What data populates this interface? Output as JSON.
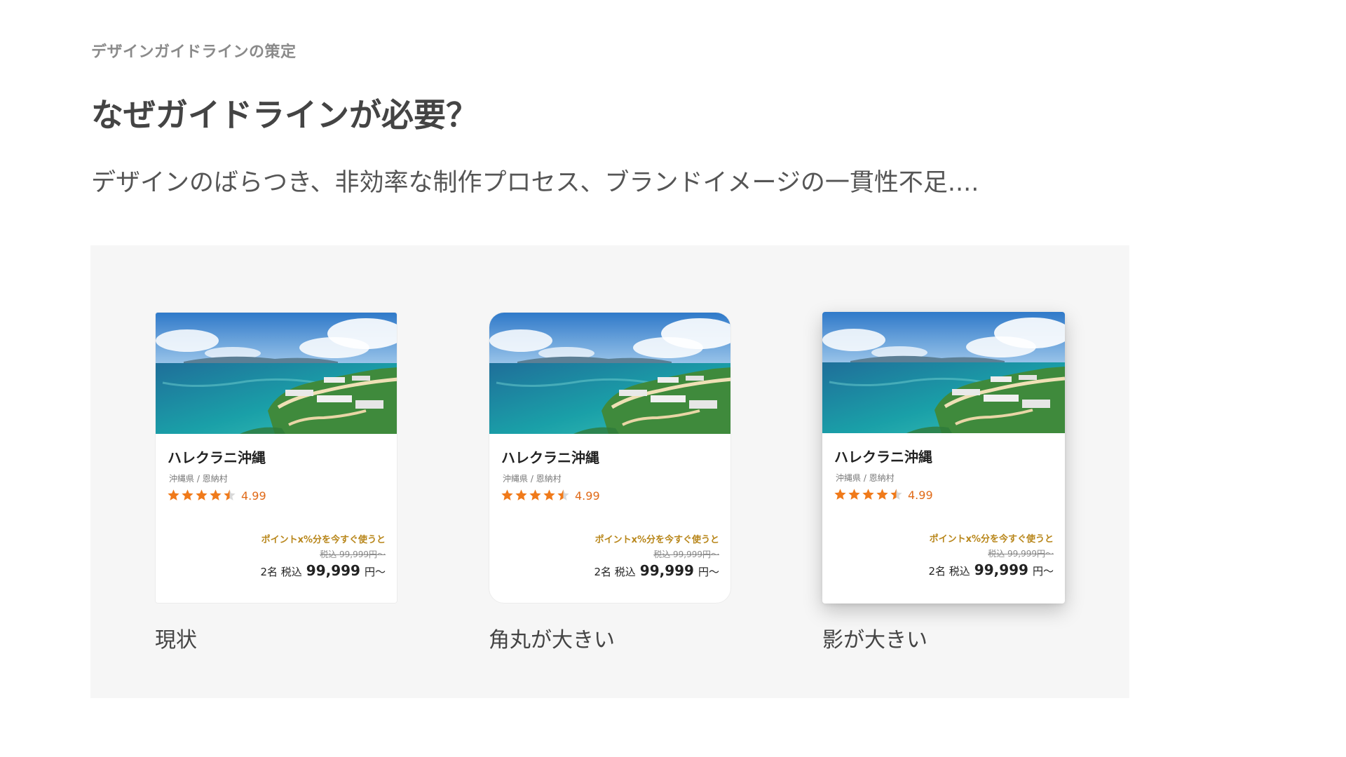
{
  "header": {
    "eyebrow": "デザインガイドラインの策定",
    "headline": "なぜガイドラインが必要？",
    "lead": "デザインのばらつき、非効率な制作プロセス、ブランドイメージの一貫性不足...."
  },
  "cards": [
    {
      "name": "ハレクラニ沖縄",
      "location": "沖縄県 / 恩納村",
      "rating_value": 4.5,
      "rating": "4.99",
      "points": "ポイントx%分を今すぐ使うと",
      "old_price": "税込 99,999円〜",
      "guests": "2名 税込",
      "price": "99,999",
      "unit": "円〜",
      "caption": "現状"
    },
    {
      "name": "ハレクラニ沖縄",
      "location": "沖縄県 / 恩納村",
      "rating_value": 4.5,
      "rating": "4.99",
      "points": "ポイントx%分を今すぐ使うと",
      "old_price": "税込 99,999円〜",
      "guests": "2名 税込",
      "price": "99,999",
      "unit": "円〜",
      "caption": "角丸が大きい"
    },
    {
      "name": "ハレクラニ沖縄",
      "location": "沖縄県 / 恩納村",
      "rating_value": 4.5,
      "rating": "4.99",
      "points": "ポイントx%分を今すぐ使うと",
      "old_price": "税込 99,999円〜",
      "guests": "2名 税込",
      "price": "99,999",
      "unit": "円〜",
      "caption": "影が大きい"
    }
  ],
  "colors": {
    "star": "#f07a1a",
    "star_empty": "#d9d9d9",
    "rating_text": "#e06a18",
    "points_text": "#b8861a",
    "panel_bg": "#f6f6f6"
  },
  "icons": {
    "star": "star-icon"
  }
}
